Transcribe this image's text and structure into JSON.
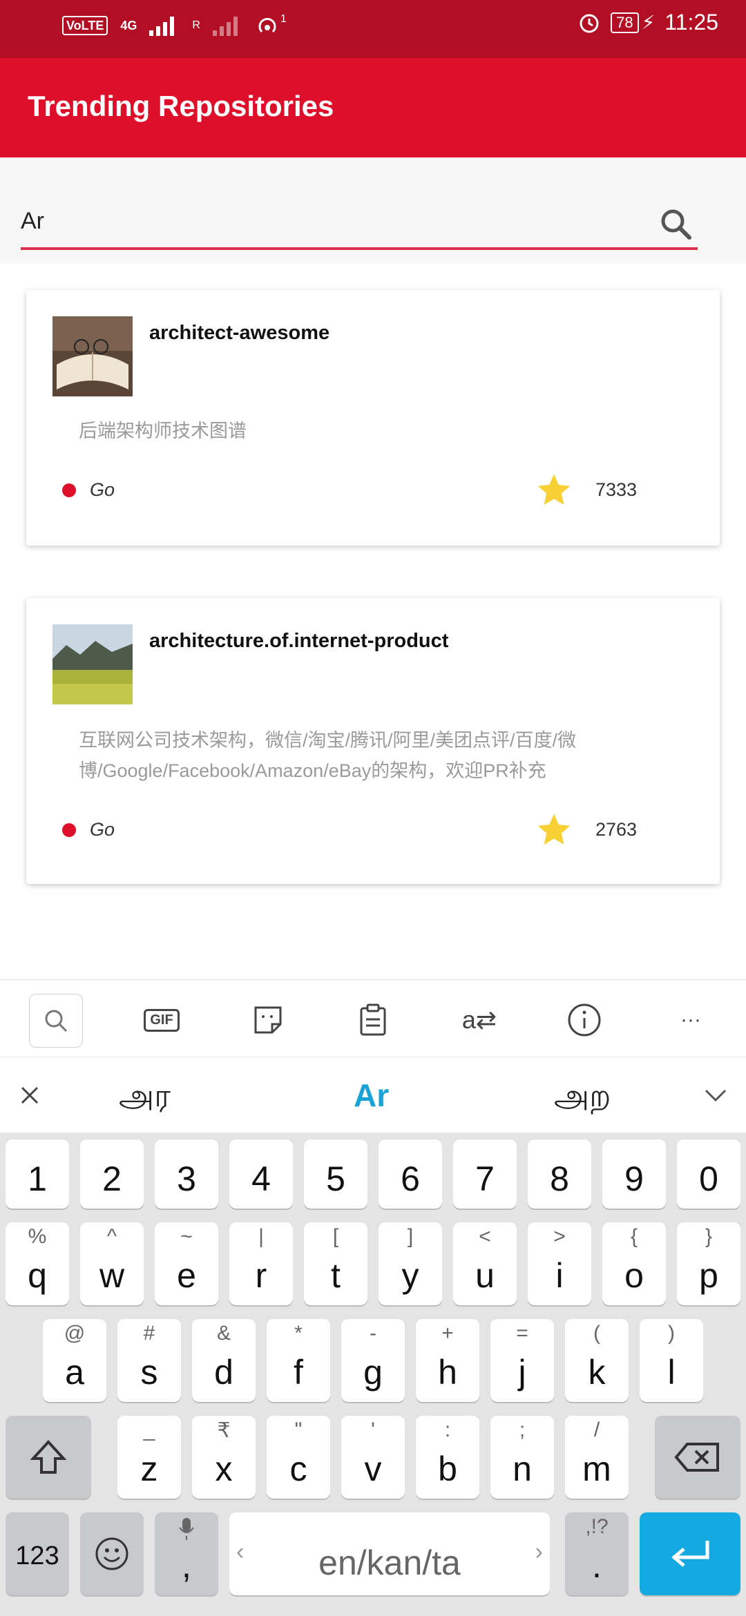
{
  "status_bar": {
    "volte": "VoLTE",
    "network": "4G",
    "roaming": "R",
    "hotspot_count": "1",
    "battery": "78",
    "time": "11:25"
  },
  "app_bar": {
    "title": "Trending Repositories"
  },
  "search": {
    "value": "Ar"
  },
  "repos": [
    {
      "name": "architect-awesome",
      "description": "后端架构师技术图谱",
      "language": "Go",
      "stars": "7333"
    },
    {
      "name": "architecture.of.internet-product",
      "description": "互联网公司技术架构，微信/淘宝/腾讯/阿里/美团点评/百度/微博/Google/Facebook/Amazon/eBay的架构，欢迎PR补充",
      "language": "Go",
      "stars": "2763"
    }
  ],
  "keyboard": {
    "toolbar": [
      "search-icon",
      "gif-icon",
      "sticker-icon",
      "clipboard-icon",
      "translate-icon",
      "info-icon",
      "more-icon"
    ],
    "gif_label": "GIF",
    "more_label": "···",
    "suggestions": [
      "அர",
      "Ar",
      "அற"
    ],
    "number_row": [
      "1",
      "2",
      "3",
      "4",
      "5",
      "6",
      "7",
      "8",
      "9",
      "0"
    ],
    "row1": [
      {
        "k": "q",
        "h": "%"
      },
      {
        "k": "w",
        "h": "^"
      },
      {
        "k": "e",
        "h": "~"
      },
      {
        "k": "r",
        "h": "|"
      },
      {
        "k": "t",
        "h": "["
      },
      {
        "k": "y",
        "h": "]"
      },
      {
        "k": "u",
        "h": "<"
      },
      {
        "k": "i",
        "h": ">"
      },
      {
        "k": "o",
        "h": "{"
      },
      {
        "k": "p",
        "h": "}"
      }
    ],
    "row2": [
      {
        "k": "a",
        "h": "@"
      },
      {
        "k": "s",
        "h": "#"
      },
      {
        "k": "d",
        "h": "&"
      },
      {
        "k": "f",
        "h": "*"
      },
      {
        "k": "g",
        "h": "-"
      },
      {
        "k": "h",
        "h": "+"
      },
      {
        "k": "j",
        "h": "="
      },
      {
        "k": "k",
        "h": "("
      },
      {
        "k": "l",
        "h": ")"
      }
    ],
    "row3": [
      {
        "k": "z",
        "h": "_"
      },
      {
        "k": "x",
        "h": "₹"
      },
      {
        "k": "c",
        "h": "\""
      },
      {
        "k": "v",
        "h": "'"
      },
      {
        "k": "b",
        "h": ":"
      },
      {
        "k": "n",
        "h": ";"
      },
      {
        "k": "m",
        "h": "/"
      }
    ],
    "sym_label": "123",
    "comma_label": ",",
    "space_label": "en/kan/ta",
    "period_label": ".",
    "period_hint": ",!?",
    "colors": {
      "accent": "#14a9e0",
      "app_bar": "#dd0f2a",
      "status_bar": "#b20f24"
    }
  }
}
